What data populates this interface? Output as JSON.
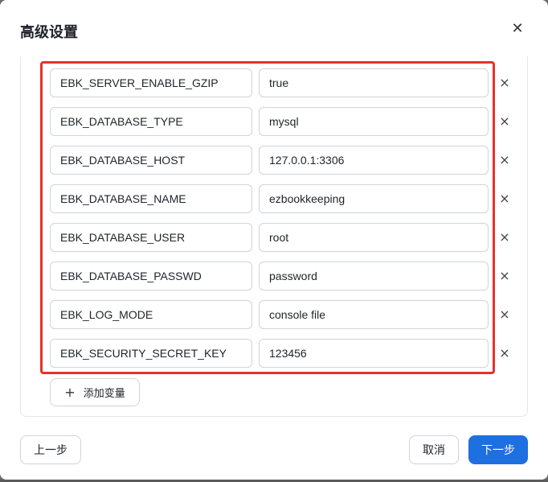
{
  "dialog": {
    "title": "高级设置",
    "close_icon": "close-icon"
  },
  "variables": [
    {
      "key": "EBK_SERVER_ENABLE_GZIP",
      "value": "true"
    },
    {
      "key": "EBK_DATABASE_TYPE",
      "value": "mysql"
    },
    {
      "key": "EBK_DATABASE_HOST",
      "value": "127.0.0.1:3306"
    },
    {
      "key": "EBK_DATABASE_NAME",
      "value": "ezbookkeeping"
    },
    {
      "key": "EBK_DATABASE_USER",
      "value": "root"
    },
    {
      "key": "EBK_DATABASE_PASSWD",
      "value": "password"
    },
    {
      "key": "EBK_LOG_MODE",
      "value": "console file"
    },
    {
      "key": "EBK_SECURITY_SECRET_KEY",
      "value": "123456"
    }
  ],
  "remove_glyph": "×",
  "add_variable": {
    "icon": "plus-icon",
    "glyph": "+",
    "label": "添加变量"
  },
  "footer": {
    "prev_label": "上一步",
    "cancel_label": "取消",
    "next_label": "下一步"
  },
  "colors": {
    "highlight": "#e5322d",
    "primary": "#1e6fe0"
  }
}
